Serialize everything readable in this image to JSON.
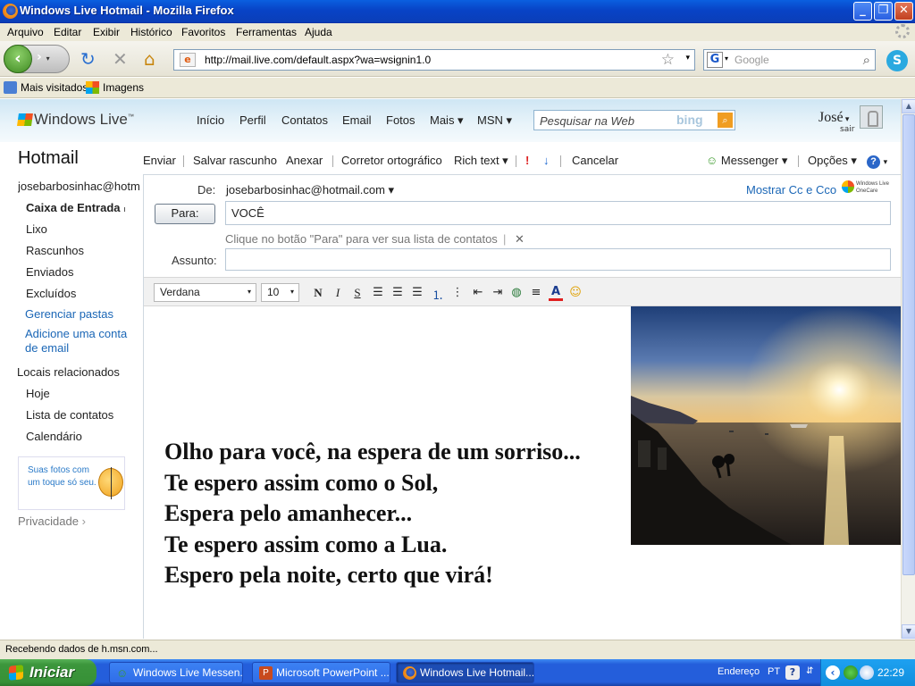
{
  "window": {
    "title": "Windows Live Hotmail - Mozilla Firefox"
  },
  "menu": [
    "Arquivo",
    "Editar",
    "Exibir",
    "Histórico",
    "Favoritos",
    "Ferramentas",
    "Ajuda"
  ],
  "nav": {
    "url": "http://mail.live.com/default.aspx?wa=wsignin1.0",
    "search_placeholder": "Google"
  },
  "bookmarks": [
    "Mais visitados",
    "Imagens"
  ],
  "live": {
    "logo": "Windows Live",
    "nav": [
      "Início",
      "Perfil",
      "Contatos",
      "Email",
      "Fotos",
      "Mais ▾",
      "MSN ▾"
    ],
    "search_placeholder": "Pesquisar na Web",
    "bing": "bing",
    "user": "José",
    "signout": "sair"
  },
  "sidebar": {
    "title": "Hotmail",
    "account": "josebarbosinhac@hotm...",
    "folders": [
      "Caixa de Entrada",
      "Lixo",
      "Rascunhos",
      "Enviados",
      "Excluídos"
    ],
    "links": [
      "Gerenciar pastas",
      "Adicione uma conta de email"
    ],
    "related_title": "Locais relacionados",
    "related": [
      "Hoje",
      "Lista de contatos",
      "Calendário"
    ],
    "ad_text": "Suas fotos com um toque só seu.",
    "privacy": "Privacidade"
  },
  "toolbar": {
    "send": "Enviar",
    "save_draft": "Salvar rascunho",
    "attach": "Anexar",
    "spellcheck": "Corretor ortográfico",
    "rich_text": "Rich text ▾",
    "cancel": "Cancelar",
    "messenger": "Messenger ▾",
    "options": "Opções ▾"
  },
  "compose": {
    "from_label": "De:",
    "from_value": "josebarbosinhac@hotmail.com ▾",
    "show_cc": "Mostrar Cc e Cco",
    "onecare": "Windows Live OneCare",
    "to_button": "Para:",
    "to_value": "VOCÊ",
    "hint": "Clique no botão \"Para\" para ver sua lista de contatos",
    "subject_label": "Assunto:",
    "subject_value": "",
    "font": "Verdana",
    "size": "10"
  },
  "body_lines": [
    "Olho para você, na espera de um sorriso...",
    "Te espero assim como o Sol,",
    "Espera pelo amanhecer...",
    "Te espero assim como a Lua.",
    "Espero pela noite, certo que virá!"
  ],
  "status": "Recebendo dados de h.msn.com...",
  "taskbar": {
    "start": "Iniciar",
    "tasks": [
      "Windows Live Messen...",
      "Microsoft PowerPoint ...",
      "Windows Live Hotmail..."
    ],
    "address": "Endereço",
    "lang": "PT",
    "clock": "22:29"
  }
}
